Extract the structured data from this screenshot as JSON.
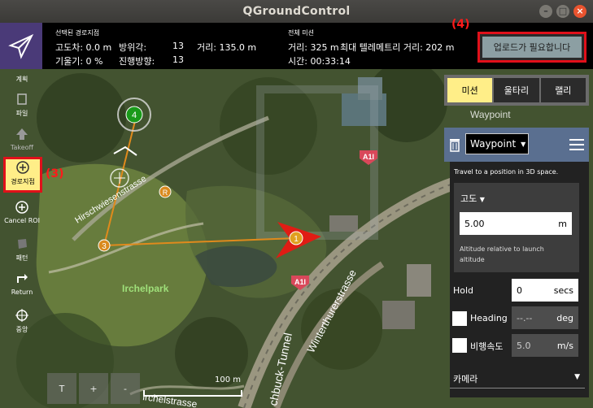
{
  "window": {
    "title": "QGroundControl"
  },
  "toolbar": {
    "selected_waypoint": {
      "header": "선택된 경로지점",
      "altitude_diff": "고도차:  0.0 m",
      "gradient": "기울기:  0 %",
      "azimuth_label": "방위각:",
      "azimuth_value": "13",
      "heading_label": "진행방향:",
      "heading_value": "13",
      "distance": "거리:  135.0 m"
    },
    "total_mission": {
      "header": "전체 미션",
      "distance": "거리:  325 m",
      "time": "시간:  00:33:14",
      "max_telemetry": "최대 텔레메트리 거리:  202 m"
    },
    "upload_label": "업로드가 필요합니다",
    "annotation_4": "(4)"
  },
  "left_tools": [
    {
      "label": "계획",
      "icon": "plan-icon"
    },
    {
      "label": "파일",
      "icon": "file-icon"
    },
    {
      "label": "Takeoff",
      "icon": "takeoff-icon"
    },
    {
      "label": "경로지점",
      "icon": "add-waypoint-icon",
      "active": true
    },
    {
      "label": "Cancel ROI",
      "icon": "cancel-roi-icon"
    },
    {
      "label": "패턴",
      "icon": "pattern-icon"
    },
    {
      "label": "Return",
      "icon": "return-icon"
    },
    {
      "label": "중앙",
      "icon": "center-icon"
    }
  ],
  "annotation_3": "(3)",
  "map": {
    "labels": {
      "street1": "Hirschwiesenstrasse",
      "park": "Irchelpark",
      "street2": "Winterthurerstrasse",
      "tunnel": "chbuck-Tunnel",
      "street3": "irchelstrasse",
      "road_sign": "A1l",
      "waypoint_prev": "Waypoint"
    },
    "markers": [
      "1",
      "3",
      "4",
      "R"
    ],
    "scale": "100 m",
    "buttons": [
      "T",
      "+",
      "-"
    ]
  },
  "panel": {
    "tabs": [
      "미션",
      "울타리",
      "랠리"
    ],
    "active_tab": "미션",
    "command": "Waypoint",
    "description": "Travel to a position in 3D space.",
    "altitude_label": "고도",
    "altitude_value": "5.00",
    "altitude_unit": "m",
    "altitude_help": "Altitude relative to launch altitude",
    "hold_label": "Hold",
    "hold_value": "0",
    "hold_unit": "secs",
    "heading_label": "Heading",
    "heading_value": "--.--",
    "heading_unit": "deg",
    "speed_label": "비행속도",
    "speed_value": "5.0",
    "speed_unit": "m/s",
    "camera_label": "카메라"
  },
  "colors": {
    "accent_yellow": "#ffee88",
    "annotation_red": "#e0101a",
    "path_orange": "#e08a1c"
  }
}
